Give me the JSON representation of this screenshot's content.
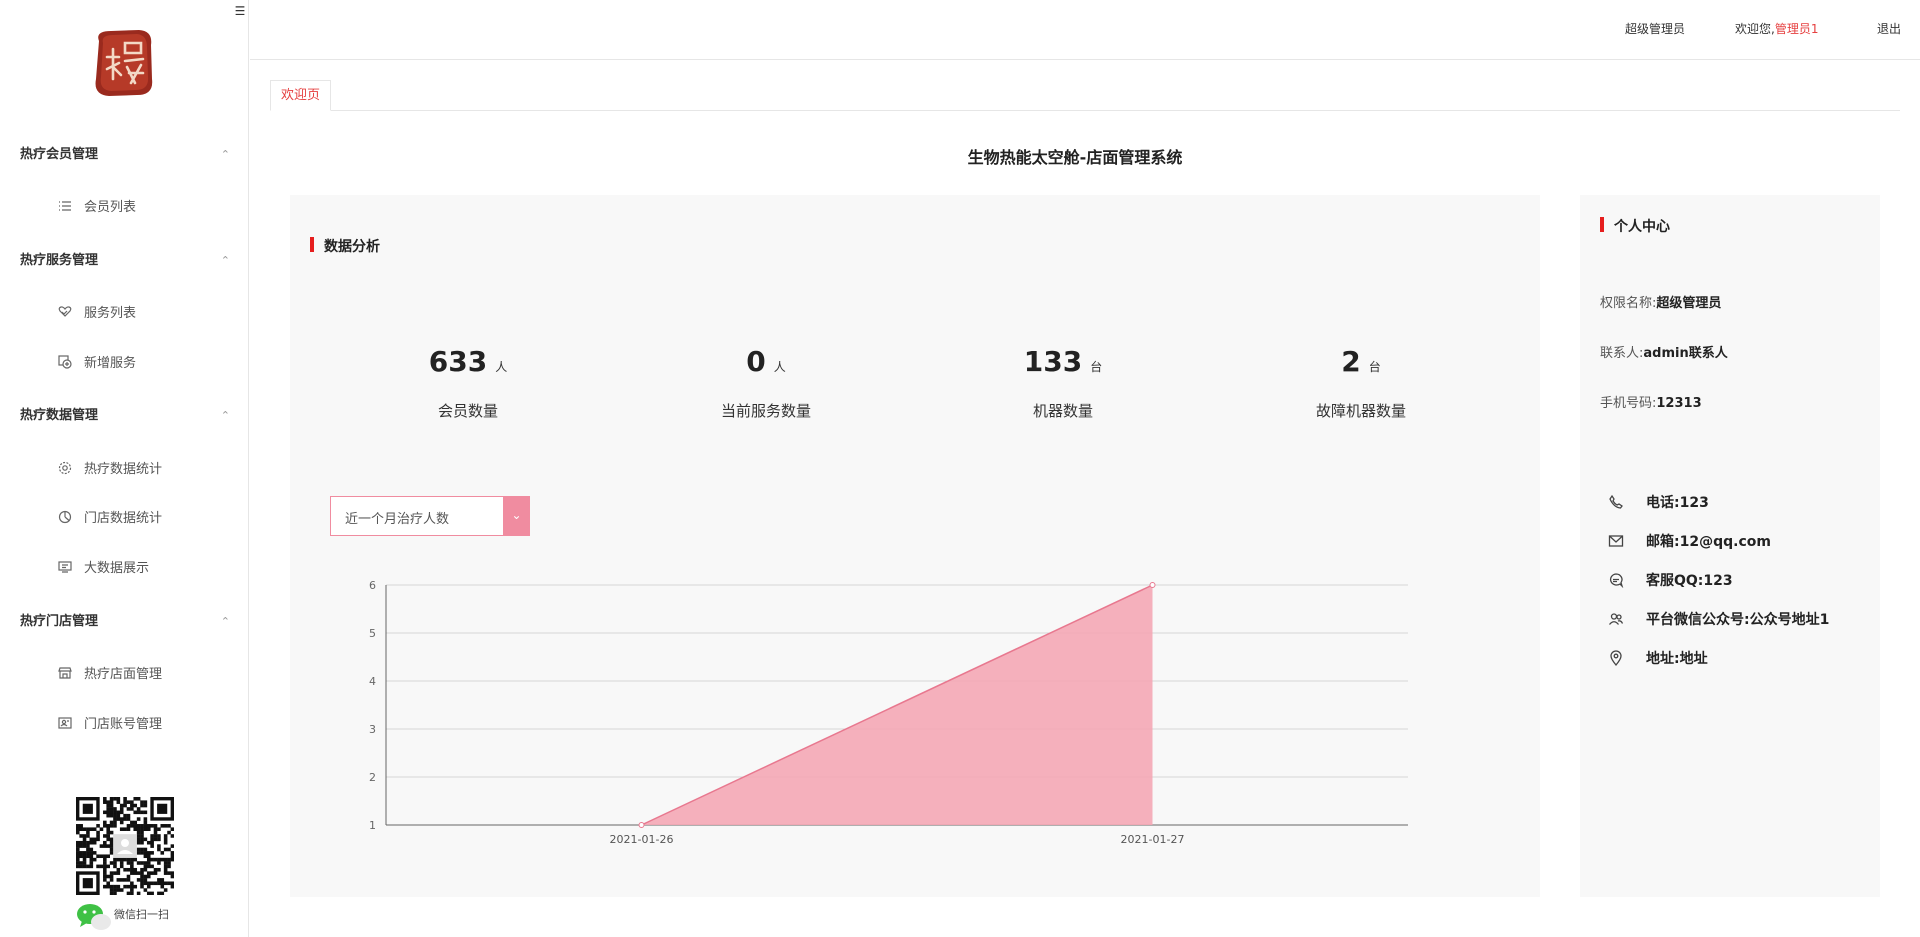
{
  "sidebar": {
    "groups": [
      {
        "title": "热疗会员管理",
        "items": [
          {
            "label": "会员列表",
            "icon": "list-icon"
          }
        ]
      },
      {
        "title": "热疗服务管理",
        "items": [
          {
            "label": "服务列表",
            "icon": "heart-hand-icon"
          },
          {
            "label": "新增服务",
            "icon": "add-square-icon"
          }
        ]
      },
      {
        "title": "热疗数据管理",
        "items": [
          {
            "label": "热疗数据统计",
            "icon": "gear-icon"
          },
          {
            "label": "门店数据统计",
            "icon": "pie-chart-icon"
          },
          {
            "label": "大数据展示",
            "icon": "monitor-icon"
          }
        ]
      },
      {
        "title": "热疗门店管理",
        "items": [
          {
            "label": "热疗店面管理",
            "icon": "store-icon"
          },
          {
            "label": "门店账号管理",
            "icon": "account-card-icon"
          }
        ]
      }
    ],
    "wechat_label": "微信扫一扫"
  },
  "header": {
    "role": "超级管理员",
    "welcome": "欢迎您,",
    "username": "管理员1",
    "logout": "退出"
  },
  "tabs": [
    {
      "label": "欢迎页"
    }
  ],
  "page_title": "生物热能太空舱-店面管理系统",
  "analysis": {
    "title": "数据分析",
    "stats": [
      {
        "value": "633",
        "unit": "人",
        "label": "会员数量"
      },
      {
        "value": "0",
        "unit": "人",
        "label": "当前服务数量"
      },
      {
        "value": "133",
        "unit": "台",
        "label": "机器数量"
      },
      {
        "value": "2",
        "unit": "台",
        "label": "故障机器数量"
      }
    ],
    "select_value": "近一个月治疗人数"
  },
  "profile": {
    "title": "个人中心",
    "fields": [
      {
        "label": "权限名称:",
        "value": "超级管理员"
      },
      {
        "label": "联系人:",
        "value": "admin联系人"
      },
      {
        "label": "手机号码:",
        "value": "12313"
      }
    ],
    "contacts": [
      {
        "icon": "phone-icon",
        "text": "电话:123"
      },
      {
        "icon": "mail-icon",
        "text": "邮箱:12@qq.com"
      },
      {
        "icon": "chat-icon",
        "text": "客服QQ:123"
      },
      {
        "icon": "people-icon",
        "text": "平台微信公众号:公众号地址1"
      },
      {
        "icon": "location-icon",
        "text": "地址:地址"
      }
    ]
  },
  "colors": {
    "accent": "#e61e1e",
    "chart_fill": "#f4a7b5",
    "chart_line": "#e8788f"
  },
  "chart_data": {
    "type": "area",
    "x": [
      "2021-01-26",
      "2021-01-27"
    ],
    "series": [
      {
        "values": [
          1,
          6
        ]
      }
    ],
    "ylim": [
      1,
      6
    ],
    "yticks": [
      1,
      2,
      3,
      4,
      5,
      6
    ],
    "grid": true,
    "title": "",
    "xlabel": "",
    "ylabel": ""
  }
}
